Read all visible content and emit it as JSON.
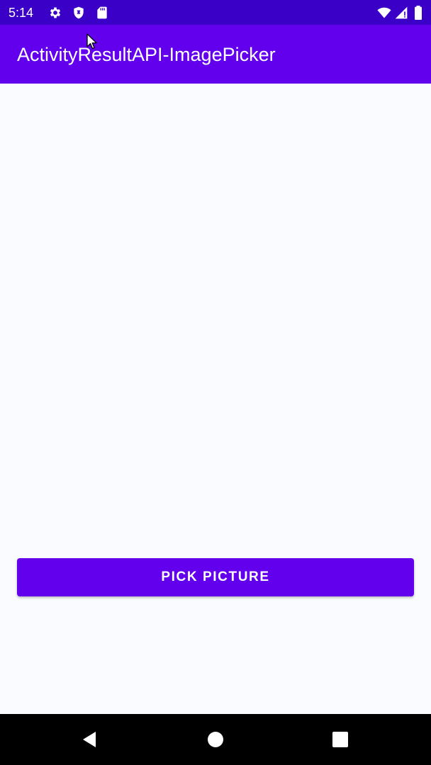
{
  "status_bar": {
    "time": "5:14",
    "icons": [
      "gear-icon",
      "shield-icon",
      "sd-card-icon",
      "wifi-icon",
      "signal-icon",
      "battery-icon"
    ]
  },
  "app_bar": {
    "title": "ActivityResultAPI-ImagePicker"
  },
  "main": {
    "pick_button_label": "PICK PICTURE"
  },
  "nav_bar": {
    "icons": [
      "back-icon",
      "home-icon",
      "recents-icon"
    ]
  },
  "colors": {
    "status_bar": "#3a00c7",
    "primary": "#6200ee",
    "background": "#fafbfe",
    "nav_bar": "#000000"
  }
}
